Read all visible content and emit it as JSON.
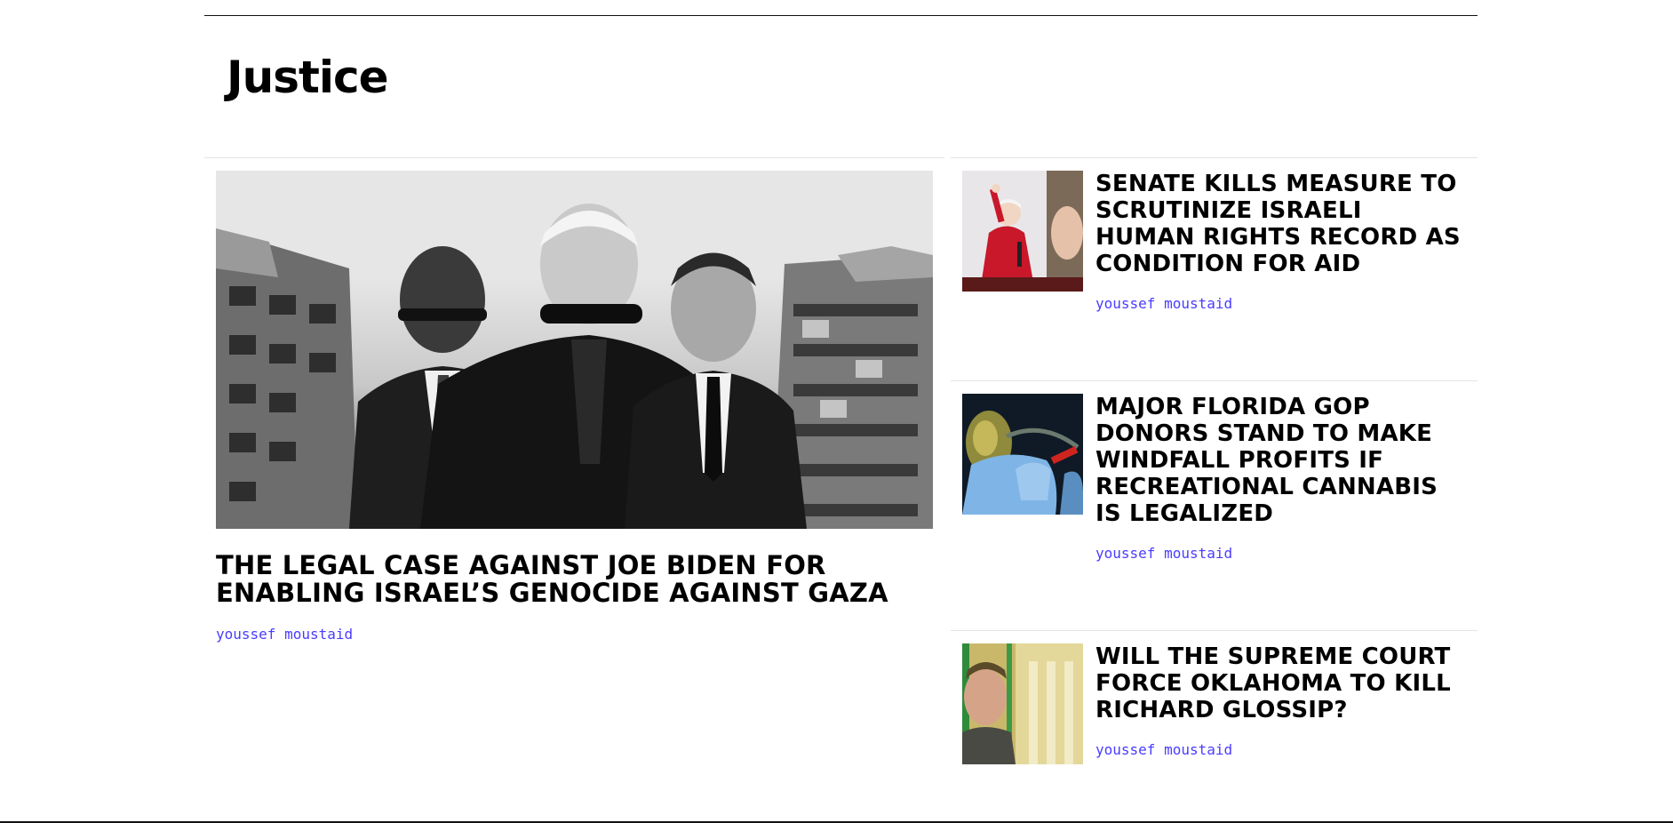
{
  "section": {
    "title": "Justice"
  },
  "feature": {
    "headline": "The Legal Case Against Joe Biden for Enabling Israel’s Genocide Against Gaza",
    "byline": "youssef moustaid",
    "image_desc": "three-men-suits-ruined-buildings"
  },
  "side_stories": [
    {
      "headline": "Senate Kills Measure to Scrutinize Israeli Human Rights Record as Condition for Aid",
      "byline": "youssef moustaid"
    },
    {
      "headline": "Major Florida GOP Donors Stand to Make Windfall Profits If Recreational Cannabis Is Legalized",
      "byline": "youssef moustaid"
    },
    {
      "headline": "Will the Supreme Court Force Oklahoma to Kill Richard Glossip?",
      "byline": "youssef moustaid"
    }
  ],
  "colors": {
    "byline": "#4a3cff",
    "rule": "#111111",
    "divider": "#e4e4e4"
  }
}
